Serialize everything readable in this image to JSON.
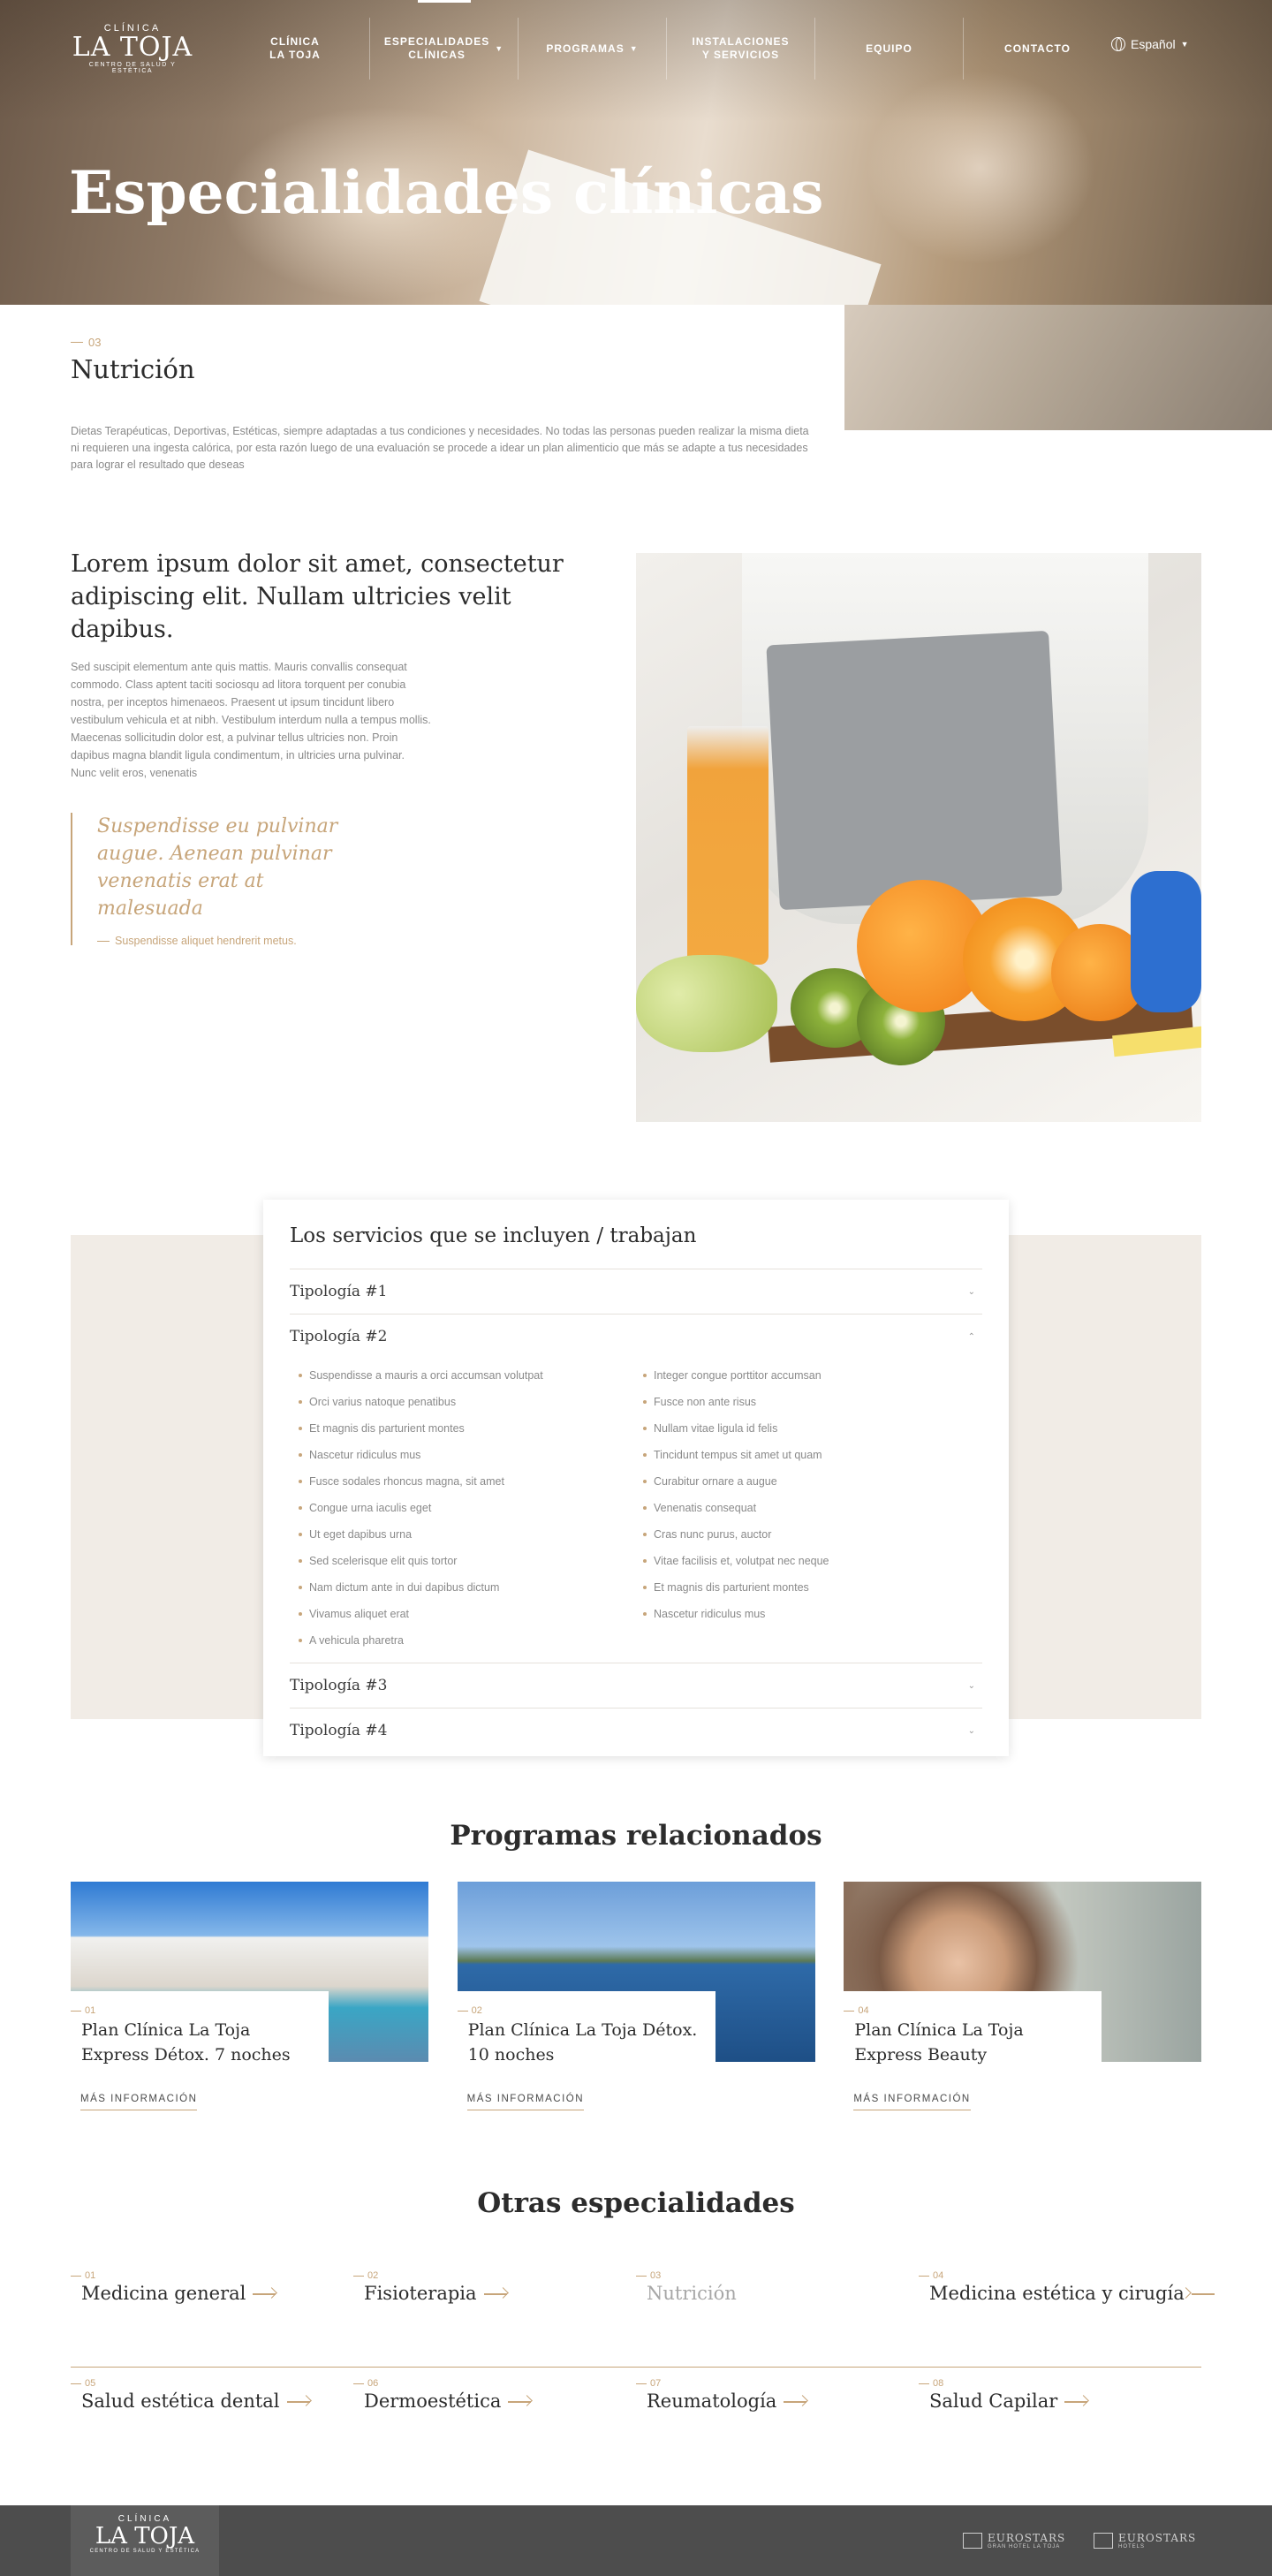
{
  "header": {
    "logo": {
      "top": "CLÍNICA",
      "main": "LA TOJA",
      "bottom": "CENTRO DE SALUD Y ESTÉTICA"
    },
    "nav": [
      {
        "label": "CLÍNICA\nLA TOJA",
        "has_caret": false,
        "active": false
      },
      {
        "label": "ESPECIALIDADES\nCLÍNICAS",
        "has_caret": true,
        "active": true
      },
      {
        "label": "PROGRAMAS",
        "has_caret": true,
        "active": false
      },
      {
        "label": "INSTALACIONES\nY SERVICIOS",
        "has_caret": false,
        "active": false
      },
      {
        "label": "EQUIPO",
        "has_caret": false,
        "active": false
      },
      {
        "label": "CONTACTO",
        "has_caret": false,
        "active": false
      }
    ],
    "language": "Español"
  },
  "hero": {
    "title": "Especialidades clínicas"
  },
  "intro": {
    "number": "03",
    "title": "Nutrición",
    "text": "Dietas Terapéuticas, Deportivas, Estéticas, siempre adaptadas a tus condiciones  y necesidades.  No todas las personas pueden realizar la misma dieta ni requieren una ingesta calórica, por esta razón luego de una evaluación se procede a idear un plan alimenticio que más se adapte a tus necesidades para lograr el resultado que deseas"
  },
  "feature": {
    "title": "Lorem ipsum dolor sit amet, consectetur adipiscing elit. Nullam ultricies velit dapibus.",
    "body": "Sed suscipit elementum ante quis mattis. Mauris convallis consequat commodo. Class aptent taciti sociosqu ad litora torquent per conubia nostra, per inceptos himenaeos. Praesent ut ipsum tincidunt libero vestibulum vehicula et at nibh. Vestibulum interdum nulla a tempus mollis. Maecenas sollicitudin dolor est, a pulvinar tellus ultricies non. Proin dapibus magna blandit ligula condimentum, in ultricies urna pulvinar. Nunc velit eros, venenatis",
    "quote": "Suspendisse eu pulvinar augue. Aenean pulvinar venenatis erat at malesuada",
    "quote_cite": "Suspendisse aliquet hendrerit metus."
  },
  "services": {
    "title": "Los servicios que se incluyen / trabajan",
    "items": [
      {
        "label": "Tipología #1",
        "open": false
      },
      {
        "label": "Tipología #2",
        "open": true
      },
      {
        "label": "Tipología #3",
        "open": false
      },
      {
        "label": "Tipología #4",
        "open": false
      }
    ],
    "open_list_left": [
      "Suspendisse a mauris a orci accumsan volutpat",
      "Orci varius natoque penatibus",
      "Et magnis dis parturient montes",
      "Nascetur ridiculus mus",
      "Fusce sodales rhoncus magna, sit amet",
      "Congue urna iaculis eget",
      "Ut eget dapibus urna",
      "Sed scelerisque elit quis tortor",
      "Nam dictum ante in dui dapibus dictum",
      "Vivamus aliquet erat",
      "A vehicula pharetra"
    ],
    "open_list_right": [
      "Integer congue porttitor accumsan",
      "Fusce non ante risus",
      "Nullam vitae ligula id felis",
      "Tincidunt tempus sit amet ut quam",
      "Curabitur ornare a augue",
      "Venenatis consequat",
      "Cras nunc purus, auctor",
      "Vitae facilisis et, volutpat nec neque",
      "Et magnis dis parturient montes",
      "Nascetur ridiculus mus"
    ]
  },
  "related": {
    "title": "Programas relacionados",
    "more_label": "MÁS INFORMACIÓN",
    "cards": [
      {
        "number": "01",
        "title": "Plan Clínica La Toja Express Détox. 7 noches"
      },
      {
        "number": "02",
        "title": "Plan Clínica La Toja Détox. 10 noches"
      },
      {
        "number": "04",
        "title": "Plan Clínica La Toja Express Beauty"
      }
    ]
  },
  "other": {
    "title": "Otras especialidades",
    "row1": [
      {
        "number": "01",
        "name": "Medicina general",
        "current": false
      },
      {
        "number": "02",
        "name": "Fisioterapia",
        "current": false
      },
      {
        "number": "03",
        "name": "Nutrición",
        "current": true
      },
      {
        "number": "04",
        "name": "Medicina estética y cirugía",
        "current": false
      }
    ],
    "row2": [
      {
        "number": "05",
        "name": "Salud estética dental",
        "current": false
      },
      {
        "number": "06",
        "name": "Dermoestética",
        "current": false
      },
      {
        "number": "07",
        "name": "Reumatología",
        "current": false
      },
      {
        "number": "08",
        "name": "Salud Capilar",
        "current": false
      }
    ]
  },
  "footer": {
    "logo": {
      "top": "CLÍNICA",
      "main": "LA TOJA",
      "bottom": "CENTRO DE SALUD Y ESTÉTICA"
    },
    "brands": [
      {
        "name": "EUROSTARS",
        "sub": "GRAN HOTEL LA TOJA"
      },
      {
        "name": "EUROSTARS",
        "sub": "HOTELS"
      }
    ]
  },
  "colors": {
    "accent": "#c7a57a",
    "services_bg": "#f1ece6",
    "footer_bg": "#4d4d4d"
  }
}
